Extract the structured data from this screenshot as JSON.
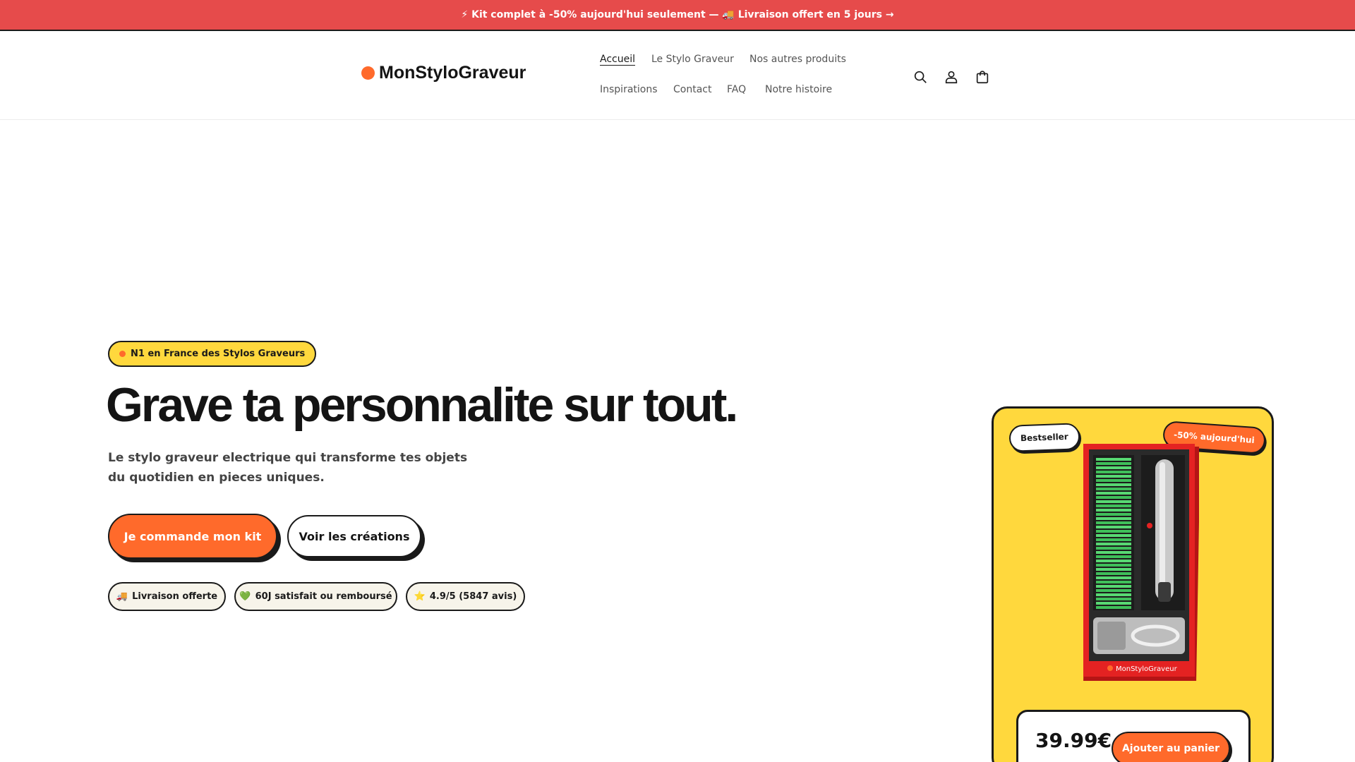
{
  "announcement": {
    "text": "⚡ Kit complet à -50% aujourd'hui seulement — 🚚 Livraison offert en 5 jours →"
  },
  "brand": {
    "name": "MonStyloGraveur",
    "accent": "#ff6a2b"
  },
  "nav": {
    "items": [
      {
        "label": "Accueil"
      },
      {
        "label": "Le Stylo Graveur"
      },
      {
        "label": "Nos autres produits"
      },
      {
        "label": "Inspirations"
      },
      {
        "label": "Contact"
      },
      {
        "label": "FAQ"
      },
      {
        "label": "Notre histoire"
      }
    ]
  },
  "header_icons": [
    "search-icon",
    "account-icon",
    "cart-icon"
  ],
  "hero": {
    "trust_pill": "N1 en France des Stylos Graveurs",
    "title": "Grave ta personnalite sur tout.",
    "subtitle": "Le stylo graveur electrique qui transforme tes objets du quotidien en pieces uniques.",
    "cta_primary": "Je commande mon kit",
    "cta_secondary": "Voir les créations",
    "badges": [
      {
        "icon": "🚚",
        "text": "Livraison offerte"
      },
      {
        "icon": "💚",
        "text": "60J satisfait ou remboursé"
      },
      {
        "icon": "⭐",
        "text": "4.9/5 (5847 avis)"
      }
    ]
  },
  "product_card": {
    "tag_left": "Bestseller",
    "tag_right": "-50% aujourd'hui",
    "box_label": "MonStyloGraveur",
    "price": "39.99€",
    "add_to_cart": "Ajouter au panier"
  },
  "colors": {
    "announcement_bg": "#e64b4b",
    "accent_orange": "#ff6a2b",
    "accent_yellow": "#ffd83d",
    "ink": "#1a1a1a"
  }
}
